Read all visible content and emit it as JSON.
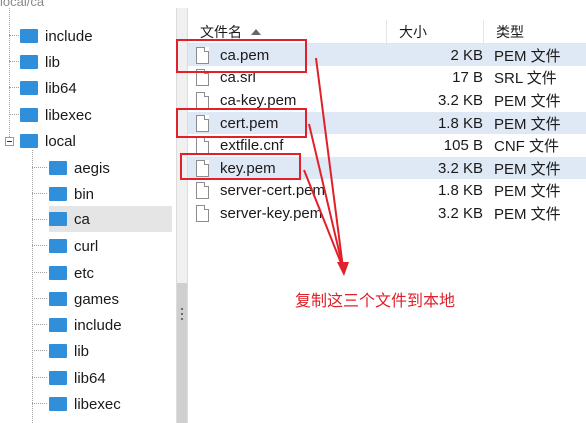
{
  "path": "local/ca",
  "tree": {
    "items": [
      {
        "label": "include"
      },
      {
        "label": "lib"
      },
      {
        "label": "lib64"
      },
      {
        "label": "libexec"
      },
      {
        "label": "local"
      },
      {
        "label": "aegis"
      },
      {
        "label": "bin"
      },
      {
        "label": "ca"
      },
      {
        "label": "curl"
      },
      {
        "label": "etc"
      },
      {
        "label": "games"
      },
      {
        "label": "include"
      },
      {
        "label": "lib"
      },
      {
        "label": "lib64"
      },
      {
        "label": "libexec"
      }
    ]
  },
  "columns": {
    "name": "文件名",
    "size": "大小",
    "type": "类型"
  },
  "files": [
    {
      "name": "ca.pem",
      "size": "2 KB",
      "type": "PEM 文件"
    },
    {
      "name": "ca.srl",
      "size": "17 B",
      "type": "SRL 文件"
    },
    {
      "name": "ca-key.pem",
      "size": "3.2 KB",
      "type": "PEM 文件"
    },
    {
      "name": "cert.pem",
      "size": "1.8 KB",
      "type": "PEM 文件"
    },
    {
      "name": "extfile.cnf",
      "size": "105 B",
      "type": "CNF 文件"
    },
    {
      "name": "key.pem",
      "size": "3.2 KB",
      "type": "PEM 文件"
    },
    {
      "name": "server-cert.pem",
      "size": "1.8 KB",
      "type": "PEM 文件"
    },
    {
      "name": "server-key.pem",
      "size": "3.2 KB",
      "type": "PEM 文件"
    }
  ],
  "annotation": {
    "text": "复制这三个文件到本地",
    "color": "#e0202a"
  },
  "colors": {
    "folder": "#2f8fdb",
    "selected_row": "#dfe9f5"
  }
}
